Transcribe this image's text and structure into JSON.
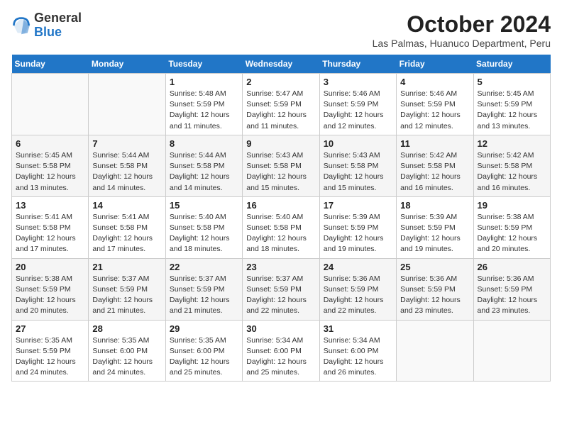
{
  "header": {
    "logo_general": "General",
    "logo_blue": "Blue",
    "month_title": "October 2024",
    "location": "Las Palmas, Huanuco Department, Peru"
  },
  "days_of_week": [
    "Sunday",
    "Monday",
    "Tuesday",
    "Wednesday",
    "Thursday",
    "Friday",
    "Saturday"
  ],
  "weeks": [
    [
      {
        "num": "",
        "info": ""
      },
      {
        "num": "",
        "info": ""
      },
      {
        "num": "1",
        "info": "Sunrise: 5:48 AM\nSunset: 5:59 PM\nDaylight: 12 hours\nand 11 minutes."
      },
      {
        "num": "2",
        "info": "Sunrise: 5:47 AM\nSunset: 5:59 PM\nDaylight: 12 hours\nand 11 minutes."
      },
      {
        "num": "3",
        "info": "Sunrise: 5:46 AM\nSunset: 5:59 PM\nDaylight: 12 hours\nand 12 minutes."
      },
      {
        "num": "4",
        "info": "Sunrise: 5:46 AM\nSunset: 5:59 PM\nDaylight: 12 hours\nand 12 minutes."
      },
      {
        "num": "5",
        "info": "Sunrise: 5:45 AM\nSunset: 5:59 PM\nDaylight: 12 hours\nand 13 minutes."
      }
    ],
    [
      {
        "num": "6",
        "info": "Sunrise: 5:45 AM\nSunset: 5:58 PM\nDaylight: 12 hours\nand 13 minutes."
      },
      {
        "num": "7",
        "info": "Sunrise: 5:44 AM\nSunset: 5:58 PM\nDaylight: 12 hours\nand 14 minutes."
      },
      {
        "num": "8",
        "info": "Sunrise: 5:44 AM\nSunset: 5:58 PM\nDaylight: 12 hours\nand 14 minutes."
      },
      {
        "num": "9",
        "info": "Sunrise: 5:43 AM\nSunset: 5:58 PM\nDaylight: 12 hours\nand 15 minutes."
      },
      {
        "num": "10",
        "info": "Sunrise: 5:43 AM\nSunset: 5:58 PM\nDaylight: 12 hours\nand 15 minutes."
      },
      {
        "num": "11",
        "info": "Sunrise: 5:42 AM\nSunset: 5:58 PM\nDaylight: 12 hours\nand 16 minutes."
      },
      {
        "num": "12",
        "info": "Sunrise: 5:42 AM\nSunset: 5:58 PM\nDaylight: 12 hours\nand 16 minutes."
      }
    ],
    [
      {
        "num": "13",
        "info": "Sunrise: 5:41 AM\nSunset: 5:58 PM\nDaylight: 12 hours\nand 17 minutes."
      },
      {
        "num": "14",
        "info": "Sunrise: 5:41 AM\nSunset: 5:58 PM\nDaylight: 12 hours\nand 17 minutes."
      },
      {
        "num": "15",
        "info": "Sunrise: 5:40 AM\nSunset: 5:58 PM\nDaylight: 12 hours\nand 18 minutes."
      },
      {
        "num": "16",
        "info": "Sunrise: 5:40 AM\nSunset: 5:58 PM\nDaylight: 12 hours\nand 18 minutes."
      },
      {
        "num": "17",
        "info": "Sunrise: 5:39 AM\nSunset: 5:59 PM\nDaylight: 12 hours\nand 19 minutes."
      },
      {
        "num": "18",
        "info": "Sunrise: 5:39 AM\nSunset: 5:59 PM\nDaylight: 12 hours\nand 19 minutes."
      },
      {
        "num": "19",
        "info": "Sunrise: 5:38 AM\nSunset: 5:59 PM\nDaylight: 12 hours\nand 20 minutes."
      }
    ],
    [
      {
        "num": "20",
        "info": "Sunrise: 5:38 AM\nSunset: 5:59 PM\nDaylight: 12 hours\nand 20 minutes."
      },
      {
        "num": "21",
        "info": "Sunrise: 5:37 AM\nSunset: 5:59 PM\nDaylight: 12 hours\nand 21 minutes."
      },
      {
        "num": "22",
        "info": "Sunrise: 5:37 AM\nSunset: 5:59 PM\nDaylight: 12 hours\nand 21 minutes."
      },
      {
        "num": "23",
        "info": "Sunrise: 5:37 AM\nSunset: 5:59 PM\nDaylight: 12 hours\nand 22 minutes."
      },
      {
        "num": "24",
        "info": "Sunrise: 5:36 AM\nSunset: 5:59 PM\nDaylight: 12 hours\nand 22 minutes."
      },
      {
        "num": "25",
        "info": "Sunrise: 5:36 AM\nSunset: 5:59 PM\nDaylight: 12 hours\nand 23 minutes."
      },
      {
        "num": "26",
        "info": "Sunrise: 5:36 AM\nSunset: 5:59 PM\nDaylight: 12 hours\nand 23 minutes."
      }
    ],
    [
      {
        "num": "27",
        "info": "Sunrise: 5:35 AM\nSunset: 5:59 PM\nDaylight: 12 hours\nand 24 minutes."
      },
      {
        "num": "28",
        "info": "Sunrise: 5:35 AM\nSunset: 6:00 PM\nDaylight: 12 hours\nand 24 minutes."
      },
      {
        "num": "29",
        "info": "Sunrise: 5:35 AM\nSunset: 6:00 PM\nDaylight: 12 hours\nand 25 minutes."
      },
      {
        "num": "30",
        "info": "Sunrise: 5:34 AM\nSunset: 6:00 PM\nDaylight: 12 hours\nand 25 minutes."
      },
      {
        "num": "31",
        "info": "Sunrise: 5:34 AM\nSunset: 6:00 PM\nDaylight: 12 hours\nand 26 minutes."
      },
      {
        "num": "",
        "info": ""
      },
      {
        "num": "",
        "info": ""
      }
    ]
  ]
}
